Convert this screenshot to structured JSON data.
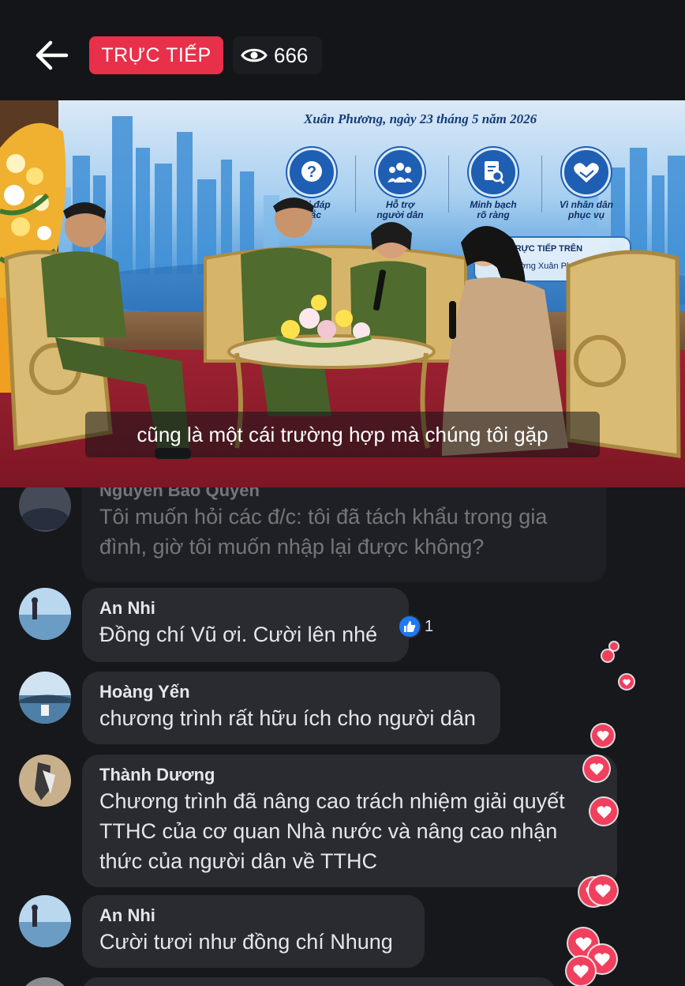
{
  "header": {
    "live_label": "TRỰC TIẾP",
    "viewer_count": "666",
    "back_icon": "back-arrow-icon",
    "viewer_icon": "eye-icon"
  },
  "video": {
    "banner_date": "Xuân Phương, ngày 23 tháng 5 năm 2026",
    "features": [
      {
        "line1": "Giải đáp",
        "line2": "mắc",
        "icon": "question-icon"
      },
      {
        "line1": "Hỗ trợ",
        "line2": "người dân",
        "icon": "people-icon"
      },
      {
        "line1": "Minh bạch",
        "line2": "rõ ràng",
        "icon": "document-search-icon"
      },
      {
        "line1": "Vì nhân dân",
        "line2": "phục vụ",
        "icon": "handshake-icon"
      }
    ],
    "broadcast_box": {
      "line1": "TRỰC TIẾP TRÊN",
      "line2": "ường Xuân Phương"
    },
    "subtitle": "cũng là một cái trường hợp mà chúng tôi gặp"
  },
  "comments": [
    {
      "name": "Nguyen Bao Quyen",
      "lines": [
        "Tôi muốn hỏi các đ/c: tôi đã tách khẩu trong gia",
        "đình, giờ tôi muốn nhập lại được không?"
      ]
    },
    {
      "name": "An Nhi",
      "lines": [
        "Đồng chí Vũ ơi. Cười lên nhé"
      ],
      "reaction_count": "1"
    },
    {
      "name": "Hoàng Yến",
      "lines": [
        "chương trình rất hữu ích cho người dân"
      ]
    },
    {
      "name": "Thành Dương",
      "lines": [
        "Chương trình đã nâng cao trách nhiệm giải quyết",
        "TTHC của cơ quan Nhà nước và nâng cao nhận",
        "thức của người dân về TTHC"
      ]
    },
    {
      "name": "An Nhi",
      "lines": [
        "Cười tươi như đồng chí Nhung"
      ]
    }
  ],
  "colors": {
    "live_red": "#e8304a",
    "heart_red": "#f0405e",
    "like_blue": "#2078f4",
    "bubble": "#2a2b30"
  }
}
